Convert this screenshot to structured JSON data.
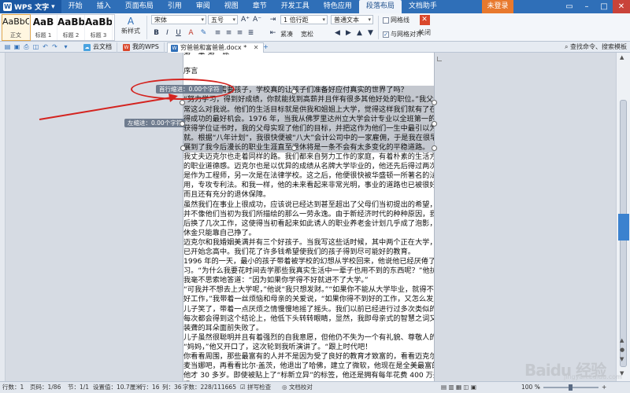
{
  "app": {
    "name": "WPS 文字",
    "login": "未登录"
  },
  "menu": [
    "开始",
    "插入",
    "页面布局",
    "引用",
    "审阅",
    "视图",
    "章节",
    "开发工具",
    "特色应用",
    "段落布局",
    "文档助手"
  ],
  "menu_active_index": 9,
  "ribbon": {
    "styles": [
      {
        "preview": "AaBbCcD",
        "label": "正文"
      },
      {
        "preview": "AaB",
        "label": "标题 1"
      },
      {
        "preview": "AaBb",
        "label": "标题 2"
      },
      {
        "preview": "AaBb",
        "label": "标题 3"
      }
    ],
    "new_style": "新样式",
    "text_tool": "文字工具",
    "font_name": "宋体",
    "font_size": "五号",
    "line_spacing": "1 倍行距",
    "paragraph_style": "普通文本",
    "grid_label": "网格线",
    "snap_grid_label": "与网格对齐",
    "close_label": "关闭",
    "delete_label": "删除",
    "tight_label": "紧凑",
    "loose_label": "宽松"
  },
  "tabs": {
    "cloud": "云文档",
    "wps": "我的WPS",
    "document": "穷爸爸和富爸爸.docx *",
    "search": "查找命令、搜索模板"
  },
  "document": {
    "lines": [
      "第一章 第一课",
      "",
      "序言",
      "",
      "有没有这种需要孩子，学校真的让孩子们准备好应付真实的世界了吗？",
      "“努力学习，得到好成绩，你就能找到高薪并且伴有很多其他好处的职位。”我父母过去",
      "常这么对我说。他们的生活目标就是供我和姐姐上大学，觉得这样我们就有了在生活中获",
      "得成功的最好机会。1976 年，当我从佛罗里达州立大学会计专业以全班第一的成绩毕业",
      "获得学位证书时，我的父母实现了他们的目标，并把这作为他们一生中最引以为自豪的成",
      "就。根据“八年计划”，我很快便被“八大”会计公司中的一家雇佣，于是我在很早就发",
      "展到了我今后漫长的职业生涯直至退休将是一条不会有太多变化的平稳道路。",
      "我丈夫迈克尔也走着同样的路。我们都来自努力工作的家庭，有着朴素的生活方式和极强",
      "的职业道德感。迈克尔也是以优异的成绩从名牌大学毕业的，他还先后得过两次：一次",
      "是作为工程师，另一次是在法律学校。这之后，他便很快被华盛顿一所著名的法律公司聘",
      "用，专攻专利法。和我一样，他的未来看起来非常光明，事业的道路也已被很好的确定了，",
      "而且还有充分的退休保障。",
      "虽然我们在事业上很成功，应该说已经达到甚至超出了父母们当初提出的希望，但生活却",
      "并不像他们当初为我们所描绘的那么一劳永逸。由于新经济时代的种种原因，我们都曾先",
      "后换了几次工作，这使得当初看起来如此诱人的职业养老金计划几乎成了泡影，我们的退",
      "休金只能靠自己挣了。",
      "迈克尔和我婚姻美满并有三个好孩子。当我写这些话时候，其中两个正在大学，另一个也",
      "已开始念高中。我们花了许多钱希望使我们的孩子得到尽可能好的教育。",
      "1996 年的一天，最小的孩子带着被学校的幻想从学校回来，他说他已经厌倦了，不想再去学",
      "习。“为什么我要花时间去学那些我真实生活中一辈子也用不到的东西呢？”他抗议道。",
      "我毫不思索地答道：“因为如果你学得不好就进不了大学。”",
      "“可我并不想去上大学呢，”他说“我只想发财。”“如果你不能从大学毕业，就得不到",
      "好工作，”我带着一丝烦恼和母亲的关爱说，“如果你得不到好的工作，又怎么发财呢？”",
      "儿子笑了，带着一点厌烦之情慢慢地摇了摇头。我们以前已经进行过多次类似的谈话了，",
      "每次都会得到这个结论上，他低下头转转眼睛，显然，我即母亲式的智慧之词又一次在",
      "装聋的耳朵面前失败了。",
      "儿子虽然很聪明并且有着强烈的自我意愿，但他仍不失为一个有礼貌、尊敬人的年轻人。",
      "“妈妈，”他又开口了，这次轮到我听演讲了。“跟上时代吧！",
      "你看看周围，那些最富有的人并不是因为受了良好的教育才致富的，看看迈克尔、乔丹和",
      "麦当娜吧，再看看比尔·盖茨，他退出了哈佛，建立了微软，他现在是全美最富的人，而",
      "他才 30 多岁。即使被贴上了“标新立异”的标签，他还是拥有每年花费 400 万美元的棒球",
      "场。”"
    ],
    "highlight_from": 4,
    "highlight_to": 10
  },
  "annotations": {
    "first_indent": "首行缩进：0.00个字符",
    "left_indent": "左缩进：0.00个字符"
  },
  "status": {
    "words": "行数：1",
    "page": "页码：1/86",
    "section": "节：1/1",
    "position": "设置值：10.7厘米",
    "row": "行：16",
    "col": "列：36",
    "count": "字数：228/111665",
    "spell": "拼写检查",
    "doc_check": "文档校对",
    "zoom": "100 %"
  },
  "watermark": "Baidu 经验",
  "watermark_sub": "jingyan.baidu.com"
}
